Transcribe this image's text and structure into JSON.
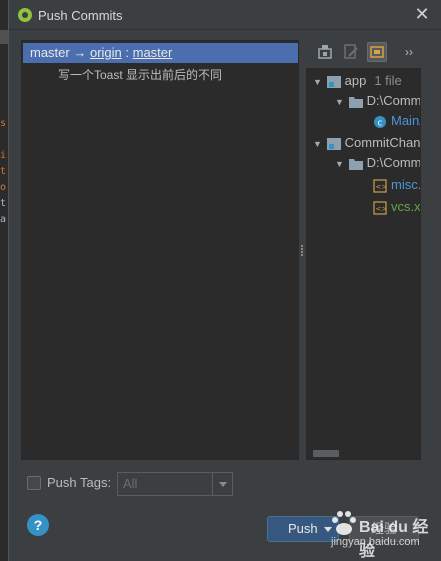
{
  "dialog": {
    "title": "Push Commits",
    "close_glyph": "✕"
  },
  "commits": {
    "branch_local": "master",
    "arrow": " → ",
    "remote": "origin",
    "separator": " : ",
    "remote_branch": "master",
    "message": "写一个Toast 显示出前后的不同"
  },
  "toolbar": {
    "icons": [
      "commit-details-icon",
      "edit-commit-icon",
      "group-by-directory-icon",
      "more-options-icon"
    ],
    "more_glyph": "››"
  },
  "tree": {
    "rows": [
      {
        "label": "app",
        "count": "1 file"
      },
      {
        "label": "D:\\Comm"
      },
      {
        "label": "MainA"
      },
      {
        "label": "CommitChang"
      },
      {
        "label": "D:\\Comm"
      },
      {
        "label": "misc.x"
      },
      {
        "label": "vcs.xm"
      }
    ]
  },
  "push_tags": {
    "label": "Push Tags:",
    "checked": false,
    "select_value": "All"
  },
  "buttons": {
    "help": "?",
    "push": "Push",
    "cancel": "经验"
  },
  "watermark": {
    "text": "Bai du 经验",
    "url": "jingyan.baidu.com"
  },
  "colors": {
    "dialog_bg": "#3c3f41",
    "panel_bg": "#2b2b2b",
    "selection": "#4b6eaf",
    "push_button": "#365880",
    "modified_file": "#4d94d8",
    "added_file": "#62a64a"
  }
}
